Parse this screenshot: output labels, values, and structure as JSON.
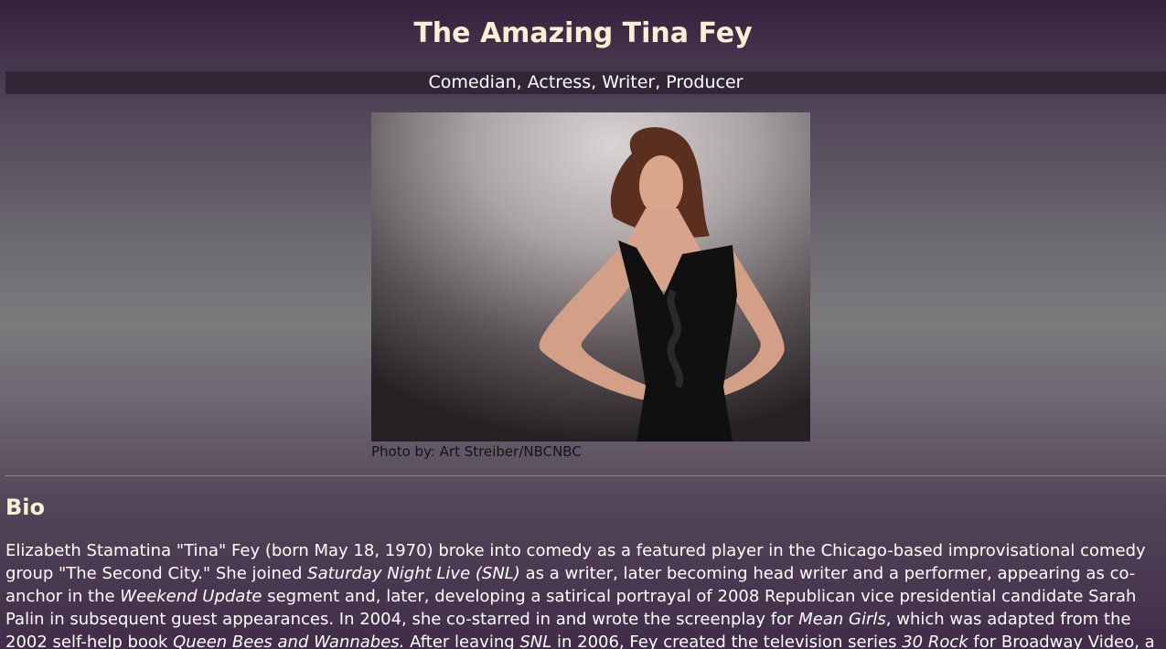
{
  "header": {
    "title": "The Amazing Tina Fey",
    "subtitle": "Comedian, Actress, Writer, Producer"
  },
  "photo": {
    "alt": "Tina Fey",
    "caption": "Photo by: Art Streiber/NBCNBC"
  },
  "bio": {
    "heading": "Bio",
    "p1": "Elizabeth Stamatina \"Tina\" Fey (born May 18, 1970) broke into comedy as a featured player in the Chicago-based improvisational comedy group \"The Second City.\" She joined ",
    "i1": "Saturday Night Live (SNL)",
    "p2": " as a writer, later becoming head writer and a performer, appearing as co-anchor in the ",
    "i2": "Weekend Update",
    "p3": " segment and, later, developing a satirical portrayal of 2008 Republican vice presidential candidate Sarah Palin in subsequent guest appearances. In 2004, she co-starred in and wrote the screenplay for ",
    "i3": "Mean Girls",
    "p4": ", which was adapted from the 2002 self-help book ",
    "i4": "Queen Bees and Wannabes.",
    "p5": " After leaving ",
    "i5": "SNL",
    "p6": " in 2006, Fey created the television series ",
    "i6": "30 Rock",
    "p7": " for Broadway Video, a sitcom loosely based on her experiences at"
  }
}
